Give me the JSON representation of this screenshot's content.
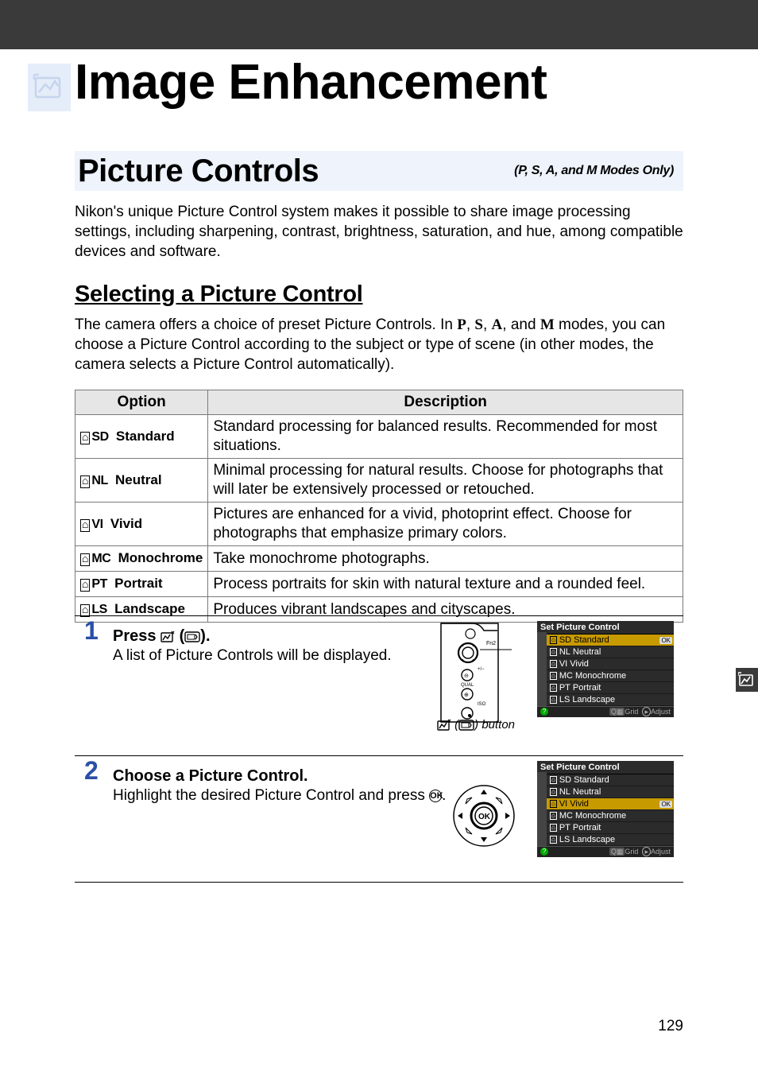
{
  "page_number": "129",
  "title": "Image Enhancement",
  "section": {
    "title": "Picture Controls",
    "note": "(P, S, A, and M Modes Only)"
  },
  "intro": "Nikon's unique Picture Control system makes it possible to share image processing settings, including sharpening, contrast, brightness, saturation, and hue, among compatible devices and software.",
  "subhead": "Selecting a Picture Control",
  "sub_intro_pre": "The camera offers a choice of preset Picture Controls.  In ",
  "modes": [
    "P",
    "S",
    "A",
    "M"
  ],
  "sub_intro_post": " modes, you can choose a Picture Control according to the subject or type of scene (in other modes, the camera selects a Picture Control automatically).",
  "table": {
    "headers": {
      "option": "Option",
      "description": "Description"
    },
    "rows": [
      {
        "code": "SD",
        "name": "Standard",
        "desc": "Standard processing for balanced results.  Recommended for most situations."
      },
      {
        "code": "NL",
        "name": "Neutral",
        "desc": "Minimal processing for natural results.  Choose for photographs that will later be extensively processed or retouched."
      },
      {
        "code": "VI",
        "name": "Vivid",
        "desc": "Pictures are enhanced for a vivid, photoprint effect.  Choose for photographs that emphasize primary colors."
      },
      {
        "code": "MC",
        "name": "Monochrome",
        "desc": "Take monochrome photographs."
      },
      {
        "code": "PT",
        "name": "Portrait",
        "desc": "Process portraits for skin with natural texture and a rounded feel."
      },
      {
        "code": "LS",
        "name": "Landscape",
        "desc": "Produces vibrant landscapes and cityscapes."
      }
    ]
  },
  "steps": {
    "s1": {
      "num": "1",
      "head_pre": "Press ",
      "head_post": ".",
      "body": "A list of Picture Controls will be displayed.",
      "caption": "button"
    },
    "s2": {
      "num": "2",
      "head": "Choose a Picture Control.",
      "body_pre": "Highlight the desired Picture Control and press ",
      "body_post": "."
    }
  },
  "menu": {
    "title": "Set Picture Control",
    "items": [
      {
        "code": "SD",
        "label": "Standard"
      },
      {
        "code": "NL",
        "label": "Neutral"
      },
      {
        "code": "VI",
        "label": "Vivid"
      },
      {
        "code": "MC",
        "label": "Monochrome"
      },
      {
        "code": "PT",
        "label": "Portrait"
      },
      {
        "code": "LS",
        "label": "Landscape"
      }
    ],
    "footer_grid": "Grid",
    "footer_adjust": "Adjust",
    "ok": "OK",
    "selected_step1": 0,
    "selected_step2": 2
  }
}
